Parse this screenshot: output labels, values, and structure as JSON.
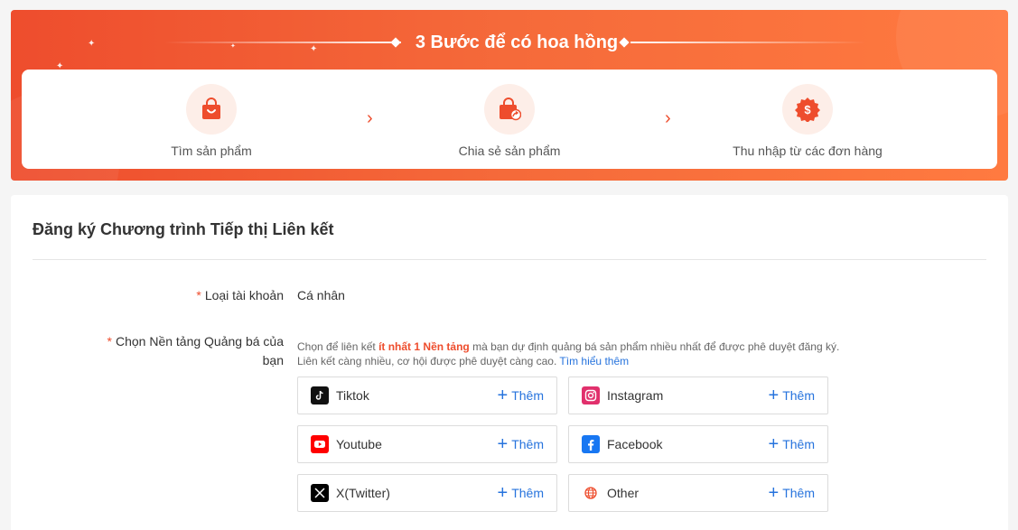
{
  "banner": {
    "title": "3 Bước để có hoa hồng",
    "steps": [
      {
        "label": "Tìm sản phẩm",
        "icon": "shopping-bag-icon"
      },
      {
        "label": "Chia sẻ sản phẩm",
        "icon": "share-bag-icon"
      },
      {
        "label": "Thu nhập từ các đơn hàng",
        "icon": "dollar-badge-icon"
      }
    ],
    "arrow_glyph": "›"
  },
  "form": {
    "title": "Đăng ký Chương trình Tiếp thị Liên kết",
    "account_type": {
      "required_mark": "*",
      "label": "Loại tài khoản",
      "value": "Cá nhân"
    },
    "platform_field": {
      "required_mark": "*",
      "label": "Chọn Nền tảng Quảng bá của bạn",
      "hint_prefix": "Chọn để liên kết ",
      "hint_highlight": "ít nhất 1 Nền tảng",
      "hint_middle": " mà bạn dự định quảng bá sản phẩm nhiều nhất để được phê duyệt đăng ký. Liên kết càng nhiều, cơ hội được phê duyệt càng cao. ",
      "hint_link": "Tìm hiểu thêm"
    },
    "platforms": [
      {
        "name": "Tiktok",
        "icon": "tiktok-icon",
        "add_label": "Thêm",
        "color": "#111111"
      },
      {
        "name": "Instagram",
        "icon": "instagram-icon",
        "add_label": "Thêm",
        "color": "#e1306c"
      },
      {
        "name": "Youtube",
        "icon": "youtube-icon",
        "add_label": "Thêm",
        "color": "#ff0000"
      },
      {
        "name": "Facebook",
        "icon": "facebook-icon",
        "add_label": "Thêm",
        "color": "#1877f2"
      },
      {
        "name": "X(Twitter)",
        "icon": "x-twitter-icon",
        "add_label": "Thêm",
        "color": "#000000"
      },
      {
        "name": "Other",
        "icon": "globe-icon",
        "add_label": "Thêm",
        "color": "#ee4d2d"
      }
    ]
  },
  "colors": {
    "brand": "#ee4d2d",
    "link": "#2673dd"
  }
}
